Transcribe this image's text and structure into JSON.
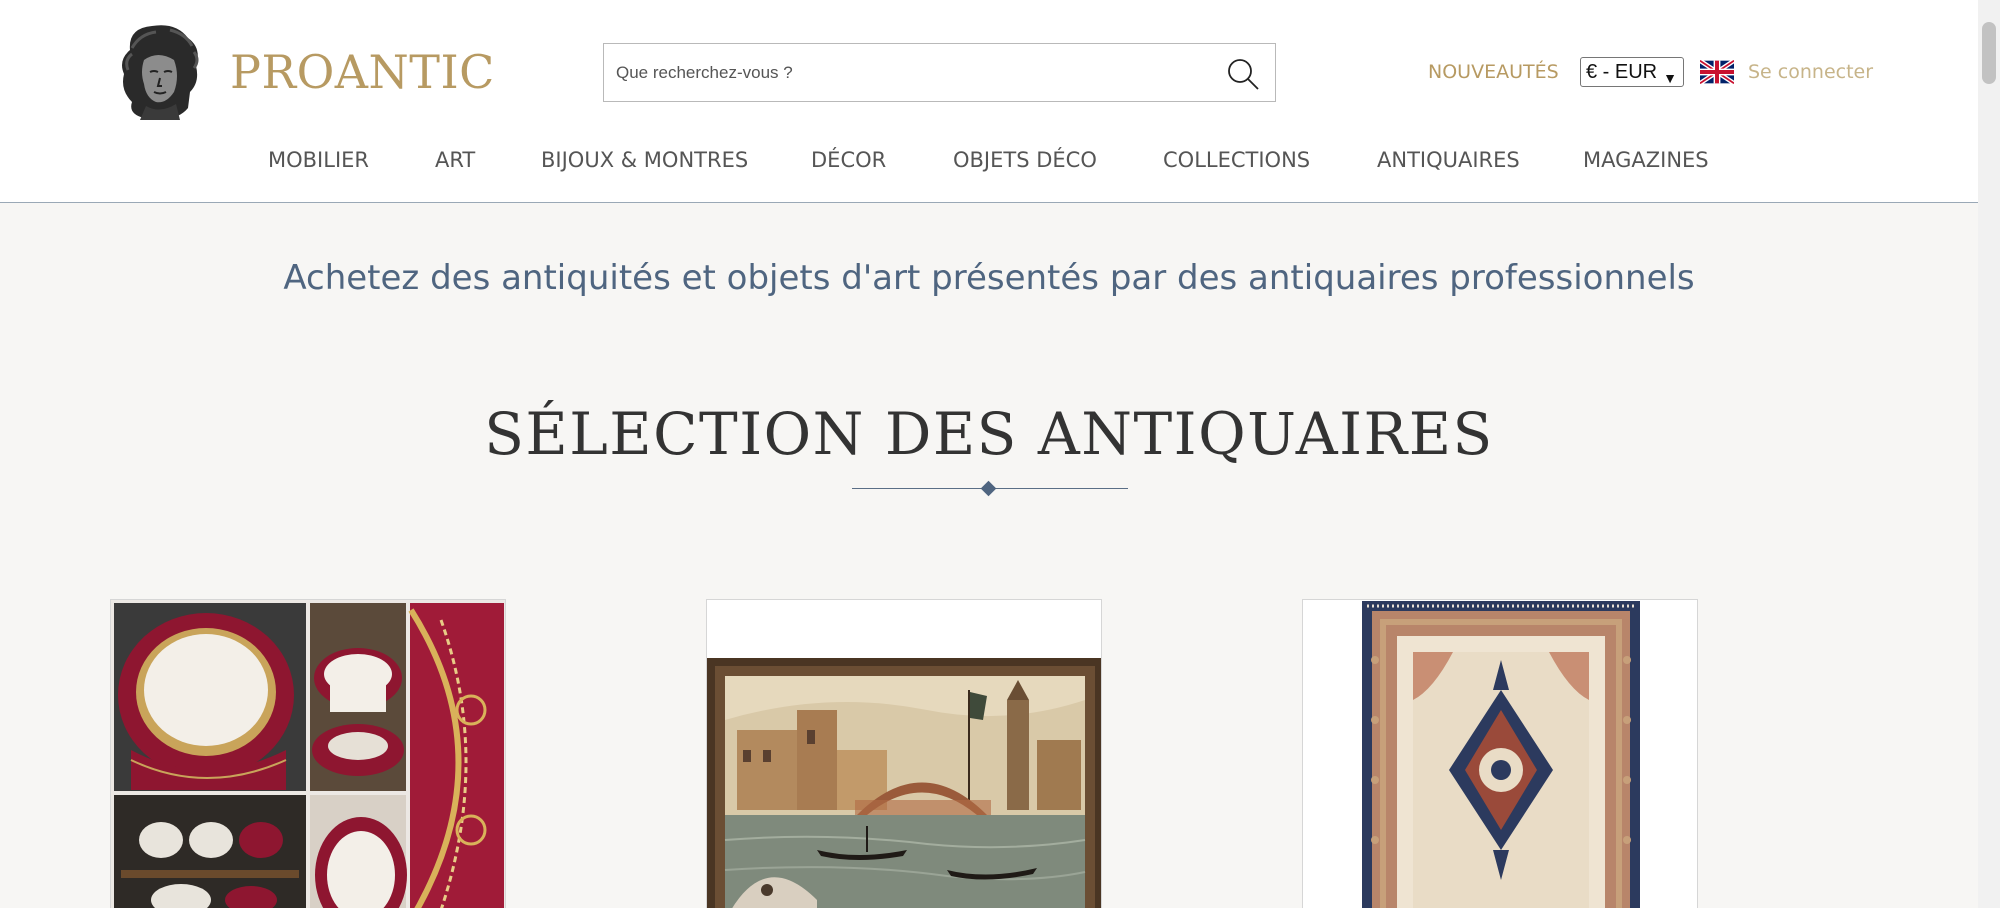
{
  "header": {
    "logo_text": "PROANTIC",
    "search": {
      "placeholder": "Que recherchez-vous ?"
    },
    "nouveautes_label": "NOUVEAUTÉS",
    "currency": {
      "selected": "€ - EUR"
    },
    "language_icon": "uk-flag-icon",
    "login_label": "Se connecter"
  },
  "nav": {
    "items": [
      {
        "label": "MOBILIER"
      },
      {
        "label": "ART"
      },
      {
        "label": "BIJOUX & MONTRES"
      },
      {
        "label": "DÉCOR"
      },
      {
        "label": "OBJETS DÉCO"
      },
      {
        "label": "COLLECTIONS"
      },
      {
        "label": "ANTIQUAIRES"
      },
      {
        "label": "MAGAZINES"
      }
    ]
  },
  "main": {
    "tagline": "Achetez des antiquités et objets d'art présentés par des antiquaires professionnels",
    "section_title": "SÉLECTION DES ANTIQUAIRES",
    "products": [
      {
        "image": "porcelain-dinner-service-image"
      },
      {
        "image": "venice-canal-painting-image"
      },
      {
        "image": "persian-rug-image"
      }
    ]
  },
  "colors": {
    "brand_gold": "#b79a62",
    "accent_blue": "#4f6580",
    "background": "#f7f6f4"
  }
}
